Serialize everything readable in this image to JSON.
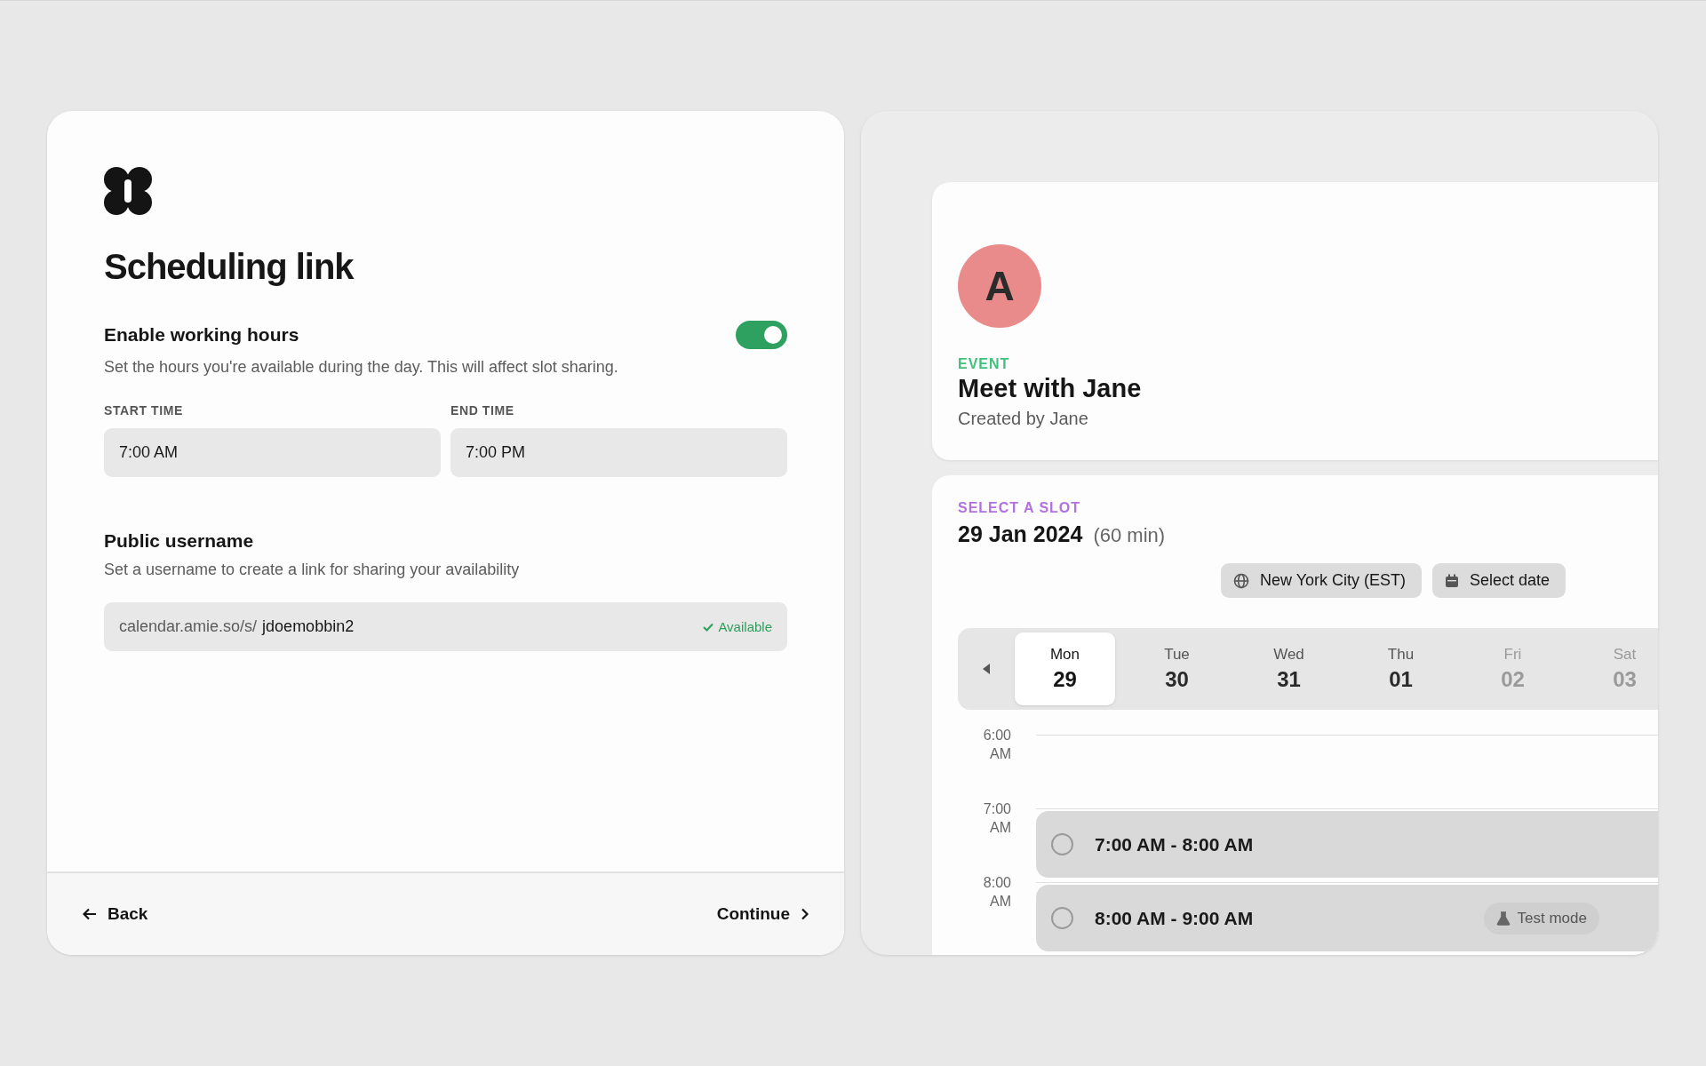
{
  "setup": {
    "title": "Scheduling link",
    "working_hours": {
      "label": "Enable working hours",
      "on": true,
      "description": "Set the hours you're available during the day. This will affect slot sharing.",
      "fields": [
        {
          "label": "START TIME",
          "value": "7:00 AM"
        },
        {
          "label": "END TIME",
          "value": "7:00 PM"
        }
      ]
    },
    "username": {
      "label": "Public username",
      "description": "Set a username to create a link for sharing your availability",
      "prefix": "calendar.amie.so/s/",
      "value": "jdoemobbin2",
      "status": "Available"
    },
    "footer": {
      "back": "Back",
      "continue": "Continue"
    }
  },
  "preview": {
    "event": {
      "avatar": "A",
      "eyebrow": "EVENT",
      "title": "Meet with Jane",
      "subtitle": "Created by Jane"
    },
    "slot_picker": {
      "eyebrow": "SELECT A SLOT",
      "date": "29 Jan 2024",
      "duration": "(60 min)",
      "timezone": "New York City (EST)",
      "select_date": "Select date",
      "days": [
        {
          "weekday": "Mon",
          "date": "29",
          "selected": true,
          "disabled": false
        },
        {
          "weekday": "Tue",
          "date": "30",
          "selected": false,
          "disabled": false
        },
        {
          "weekday": "Wed",
          "date": "31",
          "selected": false,
          "disabled": false
        },
        {
          "weekday": "Thu",
          "date": "01",
          "selected": false,
          "disabled": false
        },
        {
          "weekday": "Fri",
          "date": "02",
          "selected": false,
          "disabled": true
        },
        {
          "weekday": "Sat",
          "date": "03",
          "selected": false,
          "disabled": true
        }
      ],
      "hours": [
        {
          "label": "6:00 AM"
        },
        {
          "label": "7:00 AM",
          "slot": {
            "label": "7:00 AM - 8:00 AM",
            "selected": false
          }
        },
        {
          "label": "8:00 AM",
          "slot": {
            "label": "8:00 AM - 9:00 AM",
            "selected": false,
            "badge": "Test mode"
          }
        }
      ]
    }
  }
}
